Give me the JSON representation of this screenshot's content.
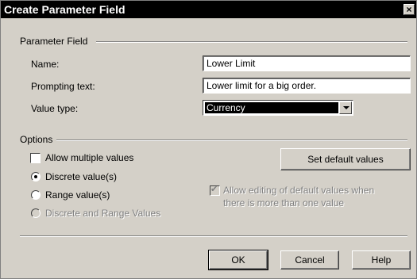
{
  "window": {
    "title": "Create Parameter Field",
    "close_glyph": "×"
  },
  "parameter_field": {
    "group_label": "Parameter Field",
    "name_label": "Name:",
    "name_value": "Lower Limit",
    "prompting_label": "Prompting text:",
    "prompting_value": "Lower limit for a big order.",
    "value_type_label": "Value type:",
    "value_type_selected": "Currency"
  },
  "options": {
    "group_label": "Options",
    "allow_multiple_label": "Allow multiple values",
    "allow_multiple_checked": false,
    "discrete_label": "Discrete value(s)",
    "discrete_checked": true,
    "range_label": "Range value(s)",
    "range_checked": false,
    "discrete_and_range_label": "Discrete and Range Values",
    "discrete_and_range_enabled": false,
    "set_default_label": "Set default values",
    "allow_editing_label_line1": "Allow editing of default values when",
    "allow_editing_label_line2": "there is more than one value",
    "allow_editing_checked": true,
    "allow_editing_enabled": false
  },
  "buttons": {
    "ok_label": "OK",
    "cancel_label": "Cancel",
    "help_label": "Help"
  }
}
